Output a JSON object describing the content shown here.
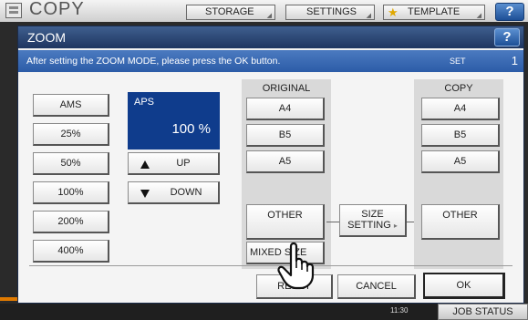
{
  "topbar": {
    "title": "COPY",
    "tabs": [
      {
        "label": "STORAGE"
      },
      {
        "label": "SETTINGS"
      },
      {
        "label": "TEMPLATE"
      }
    ],
    "help_label": "?"
  },
  "dialog": {
    "title": "ZOOM",
    "help_label": "?",
    "message": "After setting the ZOOM MODE, please press the OK button.",
    "set_label": "SET",
    "set_count": "1"
  },
  "zoom_presets": [
    "AMS",
    "25%",
    "50%",
    "100%",
    "200%",
    "400%"
  ],
  "aps": {
    "label": "APS",
    "value": "100 %"
  },
  "adjust": {
    "up_label": "UP",
    "down_label": "DOWN"
  },
  "original": {
    "label": "ORIGINAL",
    "sizes": [
      "A4",
      "B5",
      "A5"
    ],
    "other_label": "OTHER",
    "mixed_label": "MIXED SIZE"
  },
  "size_setting": {
    "line1": "SIZE",
    "line2": "SETTING"
  },
  "copy": {
    "label": "COPY",
    "sizes": [
      "A4",
      "B5",
      "A5"
    ],
    "other_label": "OTHER"
  },
  "actions": {
    "reset_label": "RESET",
    "cancel_label": "CANCEL",
    "ok_label": "OK"
  },
  "status": {
    "time": "11:30",
    "job_status_label": "JOB STATUS"
  },
  "icons": [
    "copy-app-icon",
    "star-icon",
    "help-icon",
    "up-arrow-icon",
    "down-arrow-icon",
    "hand-cursor-icon"
  ],
  "colors": {
    "title_bar": "#1e3560",
    "message_bar": "#2c5ca8",
    "aps_panel": "#0f3c8c",
    "accent_star": "#e0a800"
  }
}
